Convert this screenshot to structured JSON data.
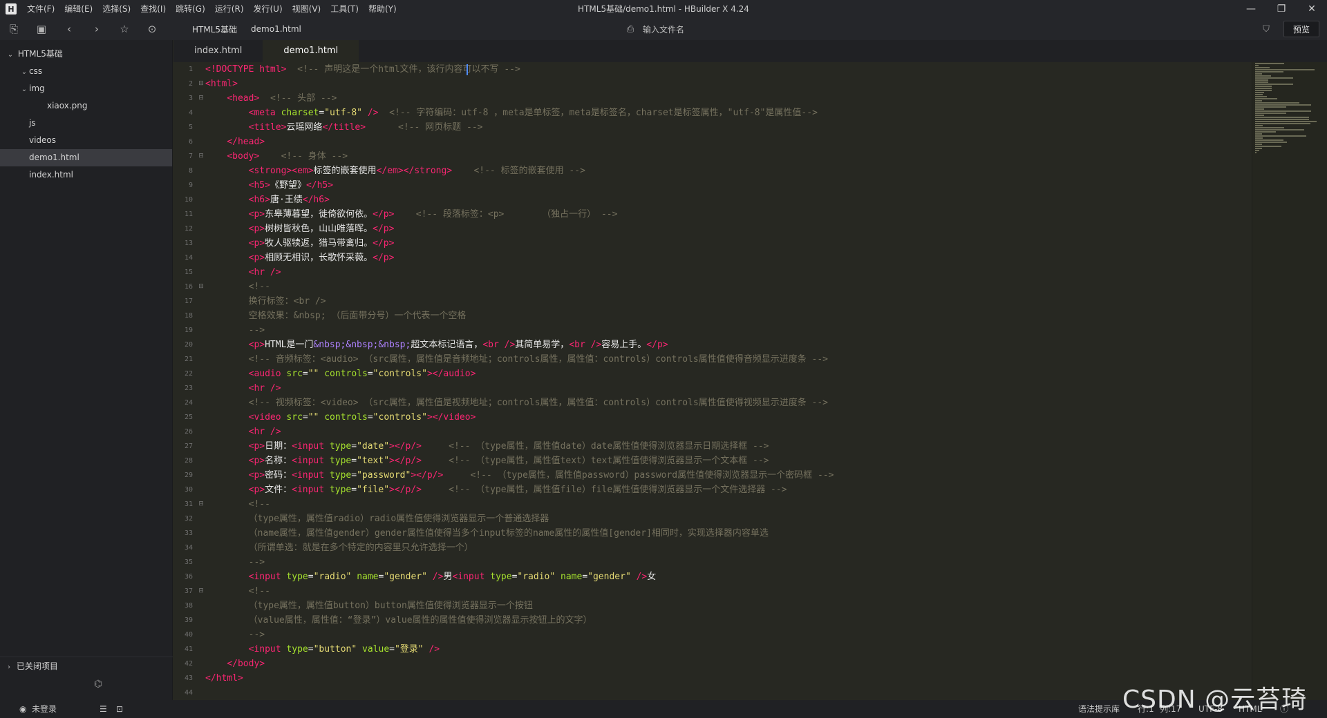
{
  "app": {
    "window_title": "HTML5基础/demo1.html - HBuilder X 4.24",
    "logo_text": "H"
  },
  "menu": [
    "文件(F)",
    "编辑(E)",
    "选择(S)",
    "查找(I)",
    "跳转(G)",
    "运行(R)",
    "发行(U)",
    "视图(V)",
    "工具(T)",
    "帮助(Y)"
  ],
  "toolbar": {
    "icons": [
      "new-file-icon",
      "save-icon",
      "back-icon",
      "forward-icon",
      "favorite-icon",
      "run-icon"
    ],
    "breadcrumbs": [
      "HTML5基础",
      "demo1.html"
    ],
    "file_search_placeholder": "输入文件名",
    "preview_label": "预览"
  },
  "sidebar": {
    "project": "HTML5基础",
    "items": [
      {
        "label": "css",
        "depth": 1,
        "arrow": "⌄"
      },
      {
        "label": "img",
        "depth": 1,
        "arrow": "⌄"
      },
      {
        "label": "xiaox.png",
        "depth": 2,
        "arrow": ""
      },
      {
        "label": "js",
        "depth": 1,
        "arrow": ""
      },
      {
        "label": "videos",
        "depth": 1,
        "arrow": ""
      },
      {
        "label": "demo1.html",
        "depth": 1,
        "arrow": "",
        "selected": true
      },
      {
        "label": "index.html",
        "depth": 1,
        "arrow": ""
      }
    ],
    "closed_projects": "已关闭项目"
  },
  "tabs": [
    {
      "label": "index.html",
      "active": false
    },
    {
      "label": "demo1.html",
      "active": true
    }
  ],
  "editor": {
    "fold_lines": [
      2,
      3,
      7,
      16,
      31,
      37
    ],
    "lines": [
      [
        [
          "t",
          "<!DOCTYPE html>"
        ],
        [
          "p",
          "  "
        ],
        [
          "c",
          "<!-- 声明这是一个html文件，该行内容可以不写 -->"
        ]
      ],
      [
        [
          "t",
          "<html>"
        ]
      ],
      [
        [
          "p",
          "    "
        ],
        [
          "t",
          "<head>"
        ],
        [
          "p",
          "  "
        ],
        [
          "c",
          "<!-- 头部 -->"
        ]
      ],
      [
        [
          "p",
          "        "
        ],
        [
          "t",
          "<meta "
        ],
        [
          "a",
          "charset"
        ],
        [
          "p",
          "="
        ],
        [
          "s",
          "\"utf-8\""
        ],
        [
          "t",
          " />"
        ],
        [
          "p",
          "  "
        ],
        [
          "c",
          "<!-- 字符编码：utf-8 ，meta是单标签，meta是标签名，charset是标签属性，\"utf-8\"是属性值-->"
        ]
      ],
      [
        [
          "p",
          "        "
        ],
        [
          "t",
          "<title>"
        ],
        [
          "p",
          "云瑶网络"
        ],
        [
          "t",
          "</title>"
        ],
        [
          "p",
          "      "
        ],
        [
          "c",
          "<!-- 网页标题 -->"
        ]
      ],
      [
        [
          "p",
          "    "
        ],
        [
          "t",
          "</head>"
        ]
      ],
      [
        [
          "p",
          "    "
        ],
        [
          "t",
          "<body>"
        ],
        [
          "p",
          "    "
        ],
        [
          "c",
          "<!-- 身体 -->"
        ]
      ],
      [
        [
          "p",
          "        "
        ],
        [
          "t",
          "<strong><em>"
        ],
        [
          "p",
          "标签的嵌套使用"
        ],
        [
          "t",
          "</em></strong>"
        ],
        [
          "p",
          "    "
        ],
        [
          "c",
          "<!-- 标签的嵌套使用 -->"
        ]
      ],
      [
        [
          "p",
          "        "
        ],
        [
          "t",
          "<h5>"
        ],
        [
          "p",
          "《野望》"
        ],
        [
          "t",
          "</h5>"
        ]
      ],
      [
        [
          "p",
          "        "
        ],
        [
          "t",
          "<h6>"
        ],
        [
          "p",
          "唐·王绩"
        ],
        [
          "t",
          "</h6>"
        ]
      ],
      [
        [
          "p",
          "        "
        ],
        [
          "t",
          "<p>"
        ],
        [
          "p",
          "东皋薄暮望，徙倚欲何依。"
        ],
        [
          "t",
          "</p>"
        ],
        [
          "p",
          "    "
        ],
        [
          "c",
          "<!-- 段落标签：<p>       （独占一行） -->"
        ]
      ],
      [
        [
          "p",
          "        "
        ],
        [
          "t",
          "<p>"
        ],
        [
          "p",
          "树树皆秋色，山山唯落晖。"
        ],
        [
          "t",
          "</p>"
        ]
      ],
      [
        [
          "p",
          "        "
        ],
        [
          "t",
          "<p>"
        ],
        [
          "p",
          "牧人驱犊返，猎马带禽归。"
        ],
        [
          "t",
          "</p>"
        ]
      ],
      [
        [
          "p",
          "        "
        ],
        [
          "t",
          "<p>"
        ],
        [
          "p",
          "相顾无相识，长歌怀采薇。"
        ],
        [
          "t",
          "</p>"
        ]
      ],
      [
        [
          "p",
          "        "
        ],
        [
          "t",
          "<hr />"
        ]
      ],
      [
        [
          "p",
          "        "
        ],
        [
          "c",
          "<!--"
        ]
      ],
      [
        [
          "p",
          "        "
        ],
        [
          "c",
          "换行标签：<br />"
        ]
      ],
      [
        [
          "p",
          "        "
        ],
        [
          "c",
          "空格效果：&nbsp; （后面带分号）一个代表一个空格"
        ]
      ],
      [
        [
          "p",
          "        "
        ],
        [
          "c",
          "-->"
        ]
      ],
      [
        [
          "p",
          "        "
        ],
        [
          "t",
          "<p>"
        ],
        [
          "p",
          "HTML是一门"
        ],
        [
          "ent",
          "&nbsp;&nbsp;&nbsp;"
        ],
        [
          "p",
          "超文本标记语言，"
        ],
        [
          "t",
          "<br />"
        ],
        [
          "p",
          "其简单易学，"
        ],
        [
          "t",
          "<br />"
        ],
        [
          "p",
          "容易上手。"
        ],
        [
          "t",
          "</p>"
        ]
      ],
      [
        [
          "p",
          "        "
        ],
        [
          "c",
          "<!-- 音频标签：<audio> （src属性，属性值是音频地址；controls属性，属性值：controls）controls属性值使得音频显示进度条 -->"
        ]
      ],
      [
        [
          "p",
          "        "
        ],
        [
          "t",
          "<audio "
        ],
        [
          "a",
          "src"
        ],
        [
          "p",
          "="
        ],
        [
          "s",
          "\"\""
        ],
        [
          "p",
          " "
        ],
        [
          "a",
          "controls"
        ],
        [
          "p",
          "="
        ],
        [
          "s",
          "\"controls\""
        ],
        [
          "t",
          "></audio>"
        ]
      ],
      [
        [
          "p",
          "        "
        ],
        [
          "t",
          "<hr />"
        ]
      ],
      [
        [
          "p",
          "        "
        ],
        [
          "c",
          "<!-- 视频标签：<video> （src属性，属性值是视频地址；controls属性，属性值：controls）controls属性值使得视频显示进度条 -->"
        ]
      ],
      [
        [
          "p",
          "        "
        ],
        [
          "t",
          "<video "
        ],
        [
          "a",
          "src"
        ],
        [
          "p",
          "="
        ],
        [
          "s",
          "\"\""
        ],
        [
          "p",
          " "
        ],
        [
          "a",
          "controls"
        ],
        [
          "p",
          "="
        ],
        [
          "s",
          "\"controls\""
        ],
        [
          "t",
          "></video>"
        ]
      ],
      [
        [
          "p",
          "        "
        ],
        [
          "t",
          "<hr />"
        ]
      ],
      [
        [
          "p",
          "        "
        ],
        [
          "t",
          "<p>"
        ],
        [
          "p",
          "日期："
        ],
        [
          "t",
          "<input "
        ],
        [
          "a",
          "type"
        ],
        [
          "p",
          "="
        ],
        [
          "s",
          "\"date\""
        ],
        [
          "t",
          "></p/>"
        ],
        [
          "p",
          "     "
        ],
        [
          "c",
          "<!-- （type属性，属性值date）date属性值使得浏览器显示日期选择框 -->"
        ]
      ],
      [
        [
          "p",
          "        "
        ],
        [
          "t",
          "<p>"
        ],
        [
          "p",
          "名称："
        ],
        [
          "t",
          "<input "
        ],
        [
          "a",
          "type"
        ],
        [
          "p",
          "="
        ],
        [
          "s",
          "\"text\""
        ],
        [
          "t",
          "></p/>"
        ],
        [
          "p",
          "     "
        ],
        [
          "c",
          "<!-- （type属性，属性值text）text属性值使得浏览器显示一个文本框 -->"
        ]
      ],
      [
        [
          "p",
          "        "
        ],
        [
          "t",
          "<p>"
        ],
        [
          "p",
          "密码："
        ],
        [
          "t",
          "<input "
        ],
        [
          "a",
          "type"
        ],
        [
          "p",
          "="
        ],
        [
          "s",
          "\"password\""
        ],
        [
          "t",
          "></p/>"
        ],
        [
          "p",
          "     "
        ],
        [
          "c",
          "<!-- （type属性，属性值password）password属性值使得浏览器显示一个密码框 -->"
        ]
      ],
      [
        [
          "p",
          "        "
        ],
        [
          "t",
          "<p>"
        ],
        [
          "p",
          "文件："
        ],
        [
          "t",
          "<input "
        ],
        [
          "a",
          "type"
        ],
        [
          "p",
          "="
        ],
        [
          "s",
          "\"file\""
        ],
        [
          "t",
          "></p/>"
        ],
        [
          "p",
          "     "
        ],
        [
          "c",
          "<!-- （type属性，属性值file）file属性值使得浏览器显示一个文件选择器 -->"
        ]
      ],
      [
        [
          "p",
          "        "
        ],
        [
          "c",
          "<!--"
        ]
      ],
      [
        [
          "p",
          "        "
        ],
        [
          "c",
          "（type属性，属性值radio）radio属性值使得浏览器显示一个普通选择器"
        ]
      ],
      [
        [
          "p",
          "        "
        ],
        [
          "c",
          "（name属性，属性值gender）gender属性值使得当多个input标签的name属性的属性值[gender]相同时，实现选择器内容单选"
        ]
      ],
      [
        [
          "p",
          "        "
        ],
        [
          "c",
          "（所谓单选：就是在多个特定的内容里只允许选择一个）"
        ]
      ],
      [
        [
          "p",
          "        "
        ],
        [
          "c",
          "-->"
        ]
      ],
      [
        [
          "p",
          "        "
        ],
        [
          "t",
          "<input "
        ],
        [
          "a",
          "type"
        ],
        [
          "p",
          "="
        ],
        [
          "s",
          "\"radio\""
        ],
        [
          "p",
          " "
        ],
        [
          "a",
          "name"
        ],
        [
          "p",
          "="
        ],
        [
          "s",
          "\"gender\""
        ],
        [
          "t",
          " />"
        ],
        [
          "p",
          "男"
        ],
        [
          "t",
          "<input "
        ],
        [
          "a",
          "type"
        ],
        [
          "p",
          "="
        ],
        [
          "s",
          "\"radio\""
        ],
        [
          "p",
          " "
        ],
        [
          "a",
          "name"
        ],
        [
          "p",
          "="
        ],
        [
          "s",
          "\"gender\""
        ],
        [
          "t",
          " />"
        ],
        [
          "p",
          "女"
        ]
      ],
      [
        [
          "p",
          "        "
        ],
        [
          "c",
          "<!--"
        ]
      ],
      [
        [
          "p",
          "        "
        ],
        [
          "c",
          "（type属性，属性值button）button属性值使得浏览器显示一个按钮"
        ]
      ],
      [
        [
          "p",
          "        "
        ],
        [
          "c",
          "（value属性，属性值：“登录”）value属性的属性值使得浏览器显示按钮上的文字）"
        ]
      ],
      [
        [
          "p",
          "        "
        ],
        [
          "c",
          "-->"
        ]
      ],
      [
        [
          "p",
          "        "
        ],
        [
          "t",
          "<input "
        ],
        [
          "a",
          "type"
        ],
        [
          "p",
          "="
        ],
        [
          "s",
          "\"button\""
        ],
        [
          "p",
          " "
        ],
        [
          "a",
          "value"
        ],
        [
          "p",
          "="
        ],
        [
          "s",
          "\"登录\""
        ],
        [
          "t",
          " />"
        ]
      ],
      [
        [
          "p",
          "    "
        ],
        [
          "t",
          "</body>"
        ]
      ],
      [
        [
          "t",
          "</html>"
        ]
      ],
      []
    ]
  },
  "statusbar": {
    "login": "未登录",
    "syntax_hint": "语法提示库",
    "line": "行:1",
    "col": "列:17",
    "encoding": "UTF-8",
    "language": "HTML"
  },
  "watermark": "CSDN @云苔琦鱼",
  "colors": {
    "tag": "#f92672",
    "attr": "#a6e22e",
    "string": "#e6db74",
    "comment": "#75715e",
    "entity": "#ae81ff"
  }
}
